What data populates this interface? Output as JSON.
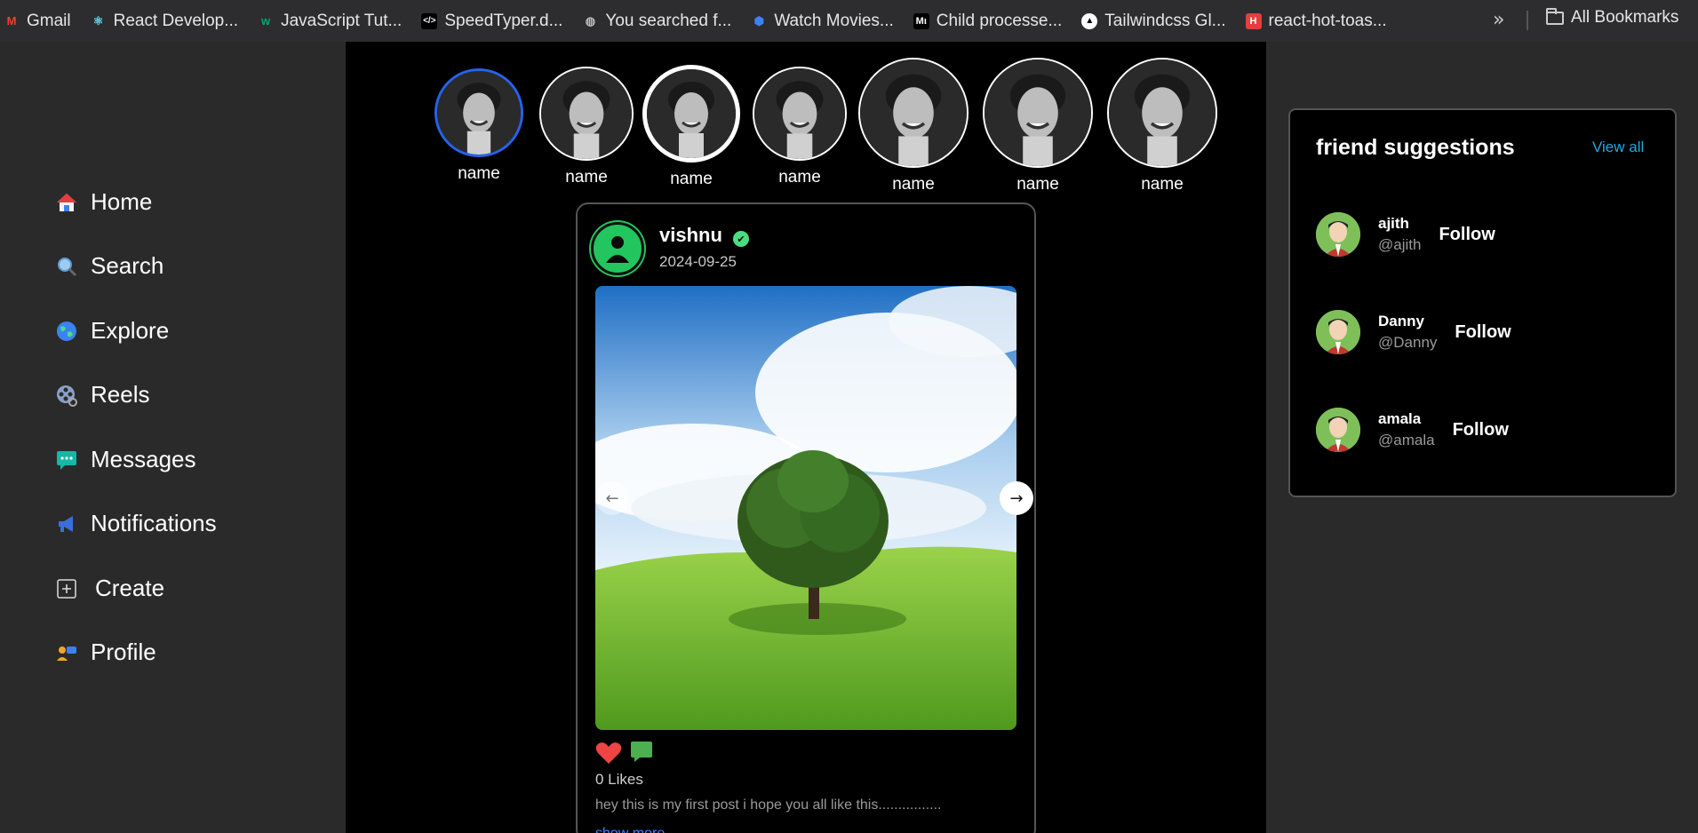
{
  "bookmarks": {
    "items": [
      {
        "label": "Gmail",
        "icon": "gmail-icon"
      },
      {
        "label": "React Develop...",
        "icon": "react-icon"
      },
      {
        "label": "JavaScript Tut...",
        "icon": "w3schools-icon"
      },
      {
        "label": "SpeedTyper.d...",
        "icon": "code-icon"
      },
      {
        "label": "You searched f...",
        "icon": "globe-icon"
      },
      {
        "label": "Watch Movies...",
        "icon": "shield-icon"
      },
      {
        "label": "Child processe...",
        "icon": "medium-icon"
      },
      {
        "label": "Tailwindcss Gl...",
        "icon": "triangle-icon"
      },
      {
        "label": "react-hot-toas...",
        "icon": "hot-toast-icon"
      }
    ],
    "more": "»",
    "all_bookmarks": "All Bookmarks"
  },
  "sidebar": {
    "items": [
      {
        "label": "Home",
        "icon": "home-icon"
      },
      {
        "label": "Search",
        "icon": "search-icon"
      },
      {
        "label": "Explore",
        "icon": "globe-icon"
      },
      {
        "label": "Reels",
        "icon": "film-reel-icon"
      },
      {
        "label": "Messages",
        "icon": "chat-icon"
      },
      {
        "label": "Notifications",
        "icon": "megaphone-icon"
      },
      {
        "label": "Create",
        "icon": "plus-square-icon"
      },
      {
        "label": "Profile",
        "icon": "profile-icon"
      }
    ]
  },
  "stories": [
    {
      "name": "name"
    },
    {
      "name": "name"
    },
    {
      "name": "name"
    },
    {
      "name": "name"
    },
    {
      "name": "name"
    },
    {
      "name": "name"
    },
    {
      "name": "name"
    }
  ],
  "post": {
    "username": "vishnu",
    "date": "2024-09-25",
    "likes": "0 Likes",
    "caption": "hey this is my first post i hope you all like this................",
    "show_more": "show more"
  },
  "suggestions": {
    "title": "friend suggestions",
    "view_all": "View all",
    "follow_label": "Follow",
    "users": [
      {
        "name": "ajith",
        "handle": "@ajith"
      },
      {
        "name": "Danny",
        "handle": "@Danny"
      },
      {
        "name": "amala",
        "handle": "@amala"
      }
    ]
  },
  "colors": {
    "active_story_ring": "#2563eb",
    "verified": "#4ade80",
    "link": "#22a7e0",
    "like": "#ef4444"
  }
}
